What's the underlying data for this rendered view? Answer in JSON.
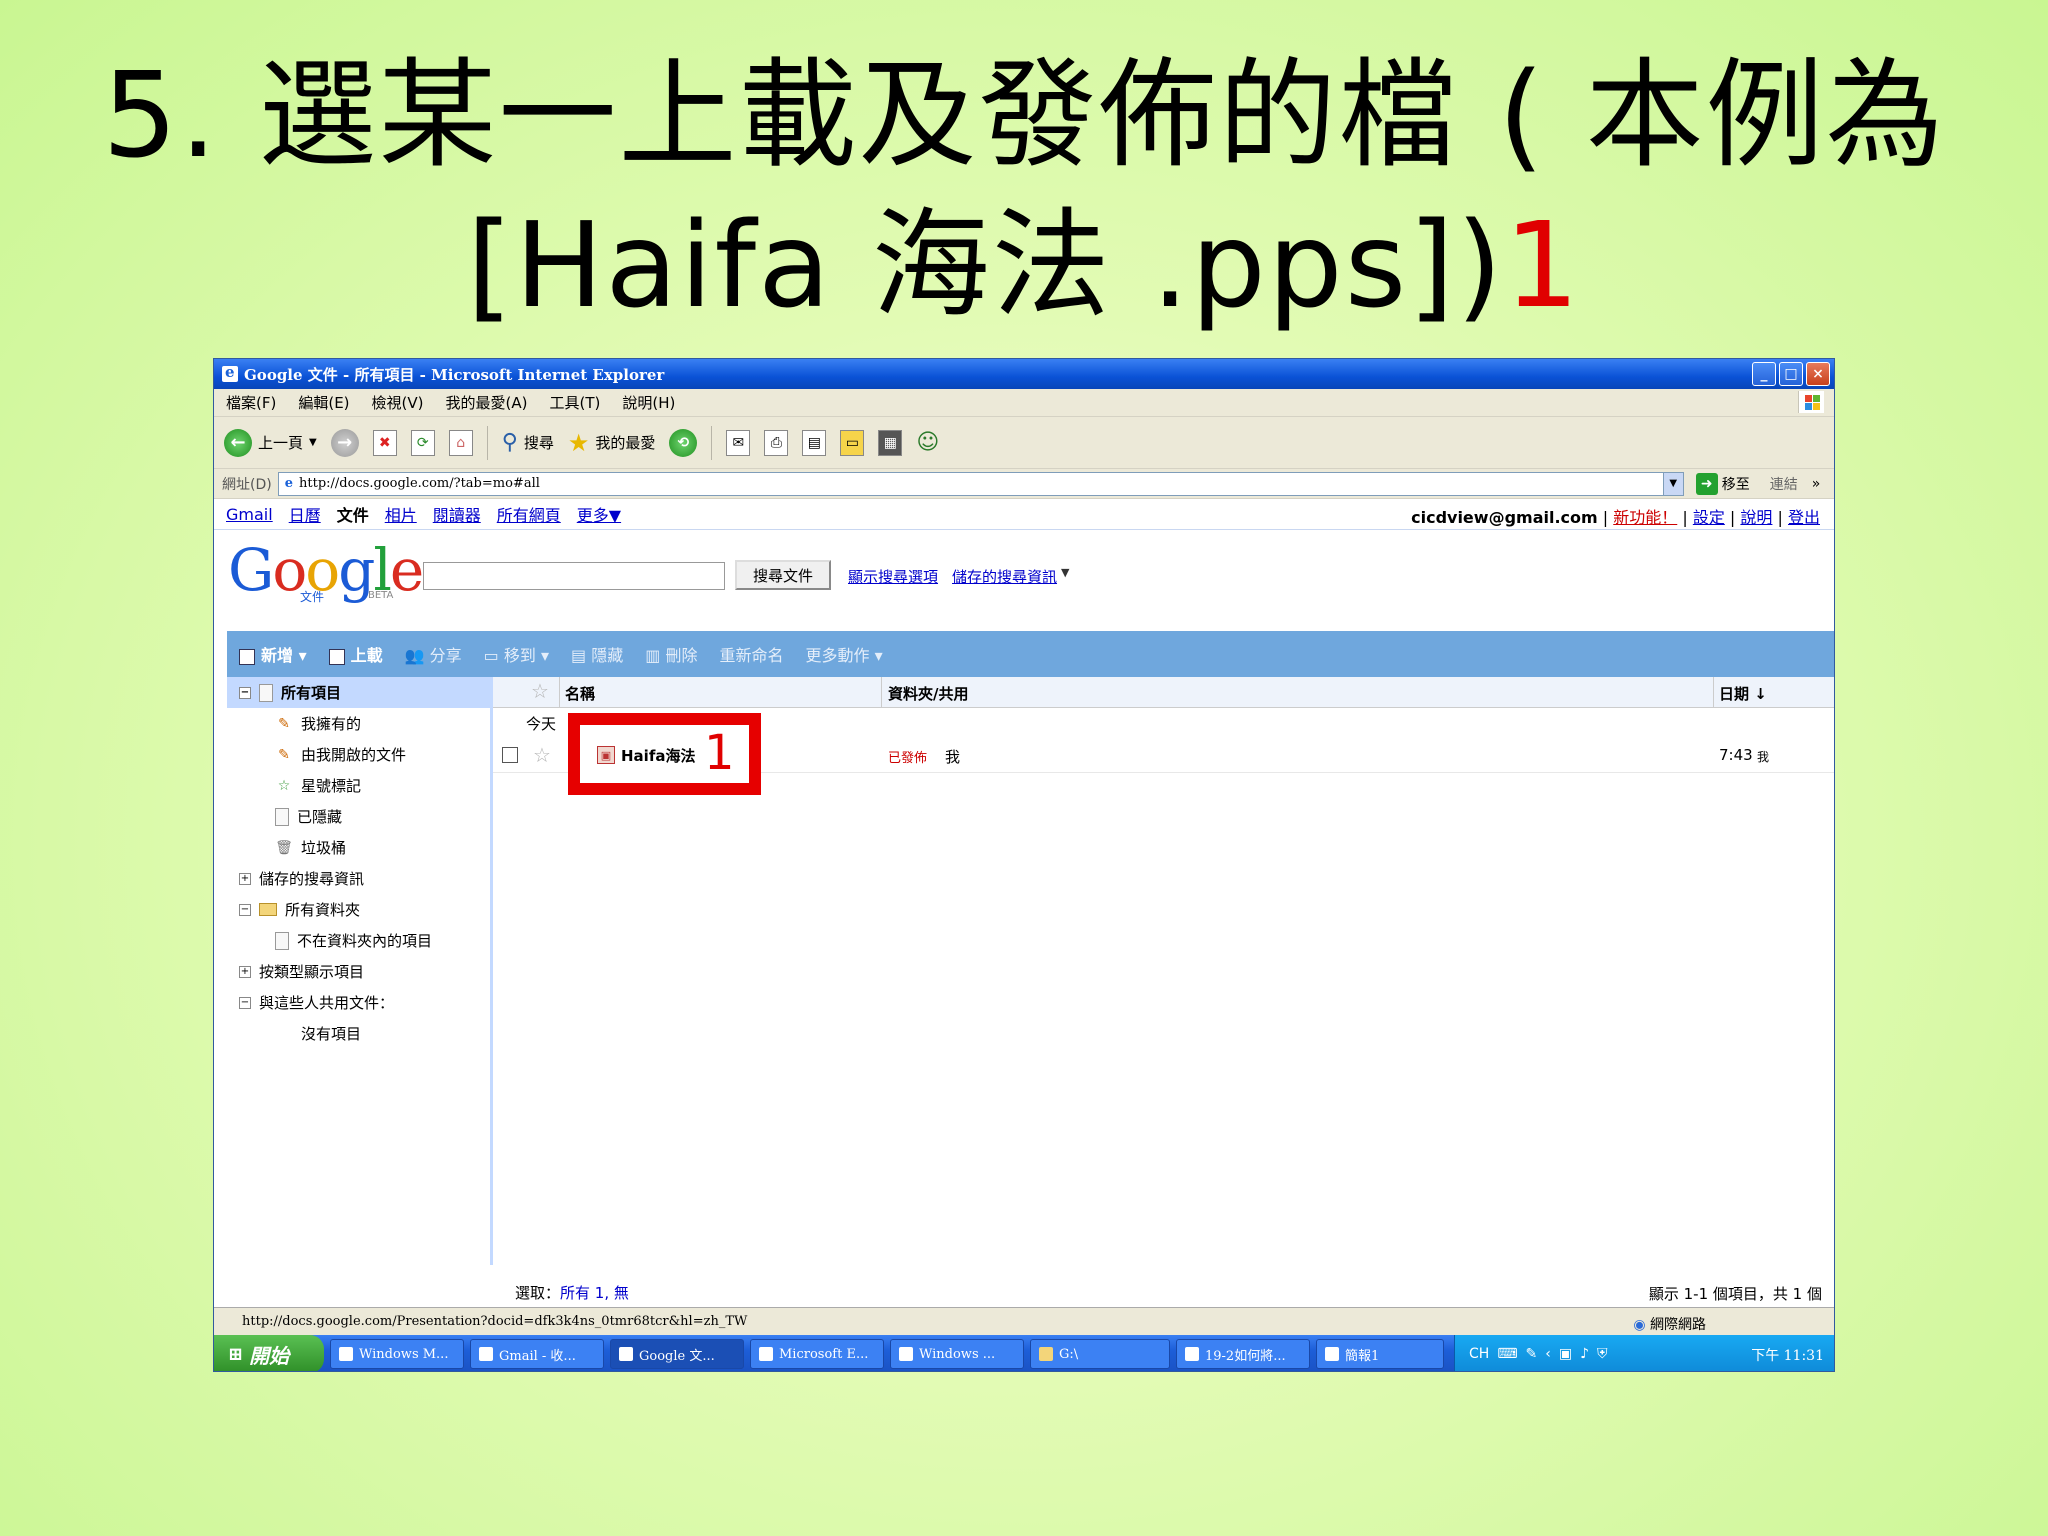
{
  "slide": {
    "title_line1": "5. 選某一上載及發佈的檔 ( 本例為",
    "title_line2": "[Haifa 海法 .pps])",
    "title_marker": "1"
  },
  "window": {
    "title": "Google 文件 - 所有項目 - Microsoft Internet Explorer",
    "min": "_",
    "max": "□",
    "close": "×"
  },
  "menu": [
    "檔案(F)",
    "編輯(E)",
    "檢視(V)",
    "我的最愛(A)",
    "工具(T)",
    "說明(H)"
  ],
  "toolbar": {
    "back": "上一頁",
    "search": "搜尋",
    "favorites": "我的最愛"
  },
  "address": {
    "label": "網址(D)",
    "url": "http://docs.google.com/?tab=mo#all",
    "go": "移至",
    "links": "連結"
  },
  "gbar": {
    "links": [
      "Gmail",
      "日曆",
      "文件",
      "相片",
      "閱讀器",
      "所有網頁",
      "更多▼"
    ],
    "account": "cicdview@gmail.com",
    "new_features": "新功能！",
    "settings": "設定",
    "help": "說明",
    "signout": "登出"
  },
  "header": {
    "logo_sub": "文件",
    "logo_beta": "BETA",
    "search_button": "搜尋文件",
    "show_options": "顯示搜尋選項",
    "saved_searches": "儲存的搜尋資訊"
  },
  "actions": {
    "new": "新增",
    "upload": "上載",
    "share": "分享",
    "move": "移到",
    "hide": "隱藏",
    "delete": "刪除",
    "rename": "重新命名",
    "more": "更多動作"
  },
  "sidebar": {
    "all_items": "所有項目",
    "owned": "我擁有的",
    "opened": "由我開啟的文件",
    "starred": "星號標記",
    "hidden": "已隱藏",
    "trash": "垃圾桶",
    "saved_searches": "儲存的搜尋資訊",
    "all_folders": "所有資料夾",
    "not_in_folder": "不在資料夾內的項目",
    "by_type": "按類型顯示項目",
    "shared_with": "與這些人共用文件：",
    "no_items": "沒有項目"
  },
  "list": {
    "col_name": "名稱",
    "col_folders": "資料夾/共用",
    "col_date": "日期 ↓",
    "group_today": "今天",
    "file_name": "Haifa海法",
    "file_marker": "1",
    "file_status": "已發佈",
    "file_owner": "我",
    "file_time": "7:43",
    "file_ampm": "我"
  },
  "selection": {
    "label": "選取：",
    "all": "所有 1,",
    "none": "無",
    "count": "顯示 1-1 個項目，共 1 個"
  },
  "status": {
    "url": "http://docs.google.com/Presentation?docid=dfk3k4ns_0tmr68tcr&hl=zh_TW",
    "zone": "網際網路"
  },
  "taskbar": {
    "start": "開始",
    "tasks": [
      "Windows M...",
      "Gmail - 收...",
      "Google 文...",
      "Microsoft E...",
      "Windows ...",
      "G:\\",
      "19-2如何將...",
      "簡報1"
    ],
    "lang": "CH",
    "clock": "下午 11:31"
  }
}
